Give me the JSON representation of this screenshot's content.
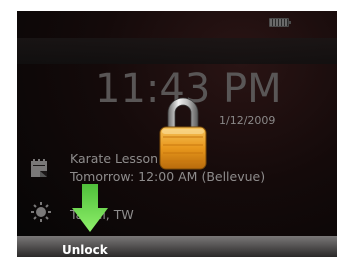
{
  "lock_screen": {
    "time": "11:43 PM",
    "date": "1/12/2009",
    "appointment": {
      "icon": "calendar-icon",
      "title": "Karate Lesson",
      "time": "Tomorrow: 12:00 AM (Bellevue)"
    },
    "weather": {
      "icon": "weather-sun-icon",
      "location": "Taipei, TW"
    },
    "lock_icon": "padlock-icon",
    "unlock": {
      "label": "Unlock",
      "arrow_icon": "down-arrow-icon"
    },
    "status_bar": {
      "battery_icon": "battery-icon"
    }
  }
}
